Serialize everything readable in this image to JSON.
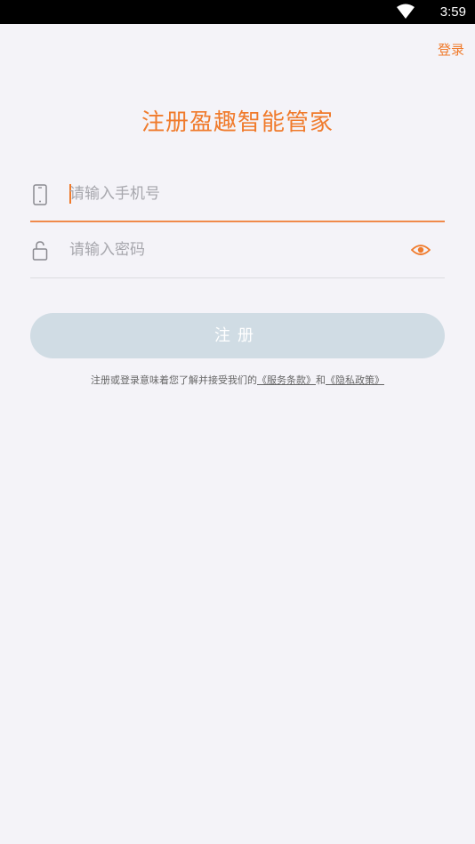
{
  "status_bar": {
    "time": "3:59"
  },
  "header": {
    "login_link": "登录"
  },
  "title": "注册盈趣智能管家",
  "phone_field": {
    "placeholder": "请输入手机号",
    "icon": "phone-icon"
  },
  "password_field": {
    "placeholder": "请输入密码",
    "icon": "lock-icon",
    "toggle_icon": "eye-icon"
  },
  "register_button": "注册",
  "terms": {
    "prefix": "注册或登录意味着您了解并接受我们的",
    "service_link": "《服务条款》",
    "conjunction": "和",
    "privacy_link": "《隐私政策》"
  },
  "colors": {
    "accent": "#f07b2c",
    "button_disabled": "#d0dce4",
    "background": "#f4f3f8"
  }
}
